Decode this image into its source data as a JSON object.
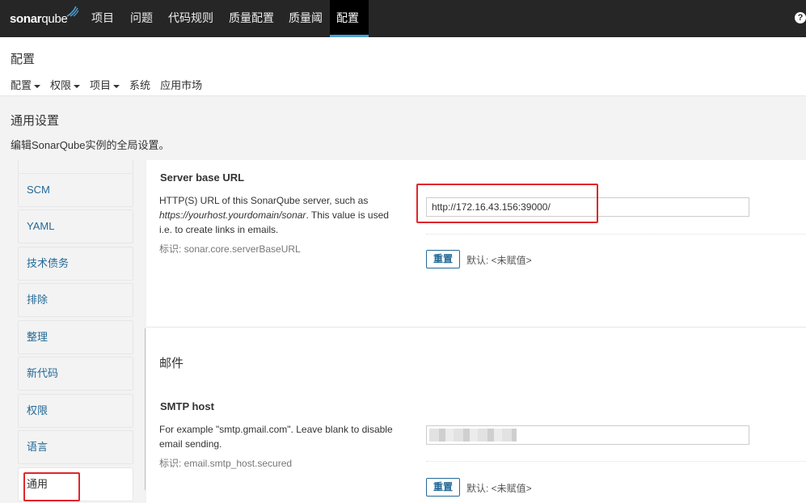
{
  "navbar": {
    "logo_text_a": "sonar",
    "logo_text_b": "qube",
    "items": [
      "项目",
      "问题",
      "代码规则",
      "质量配置",
      "质量阈",
      "配置"
    ],
    "help_icon": "?"
  },
  "page": {
    "title": "配置",
    "subnav": [
      "配置",
      "权限",
      "项目",
      "系统",
      "应用市场"
    ]
  },
  "section": {
    "title": "通用设置",
    "description": "编辑SonarQube实例的全局设置。"
  },
  "sidebar": {
    "items": [
      "SCM",
      "YAML",
      "技术债务",
      "排除",
      "整理",
      "新代码",
      "权限",
      "语言",
      "通用"
    ]
  },
  "settings": {
    "server_url": {
      "name": "Server base URL",
      "desc_line1": "HTTP(S) URL of this SonarQube server, such as",
      "desc_line2_italic": "https://yourhost.yourdomain/sonar",
      "desc_line2_rest": ". This value is used",
      "desc_line3": "i.e. to create links in emails.",
      "key": "标识: sonar.core.serverBaseURL",
      "value": "http://172.16.43.156:39000/",
      "reset_label": "重置",
      "default_label": "默认: <未赋值>"
    },
    "mail_category": "邮件",
    "smtp_host": {
      "name": "SMTP host",
      "desc_line1": "For example \"smtp.gmail.com\". Leave blank to disable",
      "desc_line2": "email sending.",
      "key": "标识: email.smtp_host.secured",
      "value": "",
      "reset_label": "重置",
      "default_label": "默认: <未赋值>"
    }
  },
  "colors": {
    "navbar_bg": "#262626",
    "accent": "#4b9fd5",
    "link": "#236a97",
    "annotation": "#e0262b"
  }
}
